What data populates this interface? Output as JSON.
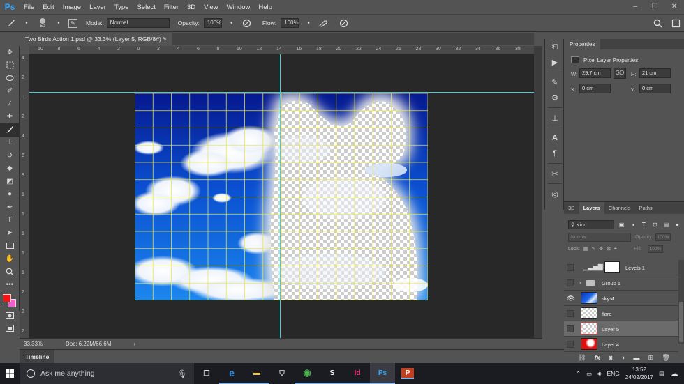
{
  "app": {
    "logo": "Ps",
    "menu": [
      "File",
      "Edit",
      "Image",
      "Layer",
      "Type",
      "Select",
      "Filter",
      "3D",
      "View",
      "Window",
      "Help"
    ],
    "window_controls": [
      "–",
      "❐",
      "✕"
    ]
  },
  "options_bar": {
    "brush_size": "50",
    "mode_label": "Mode:",
    "mode_value": "Normal",
    "opacity_label": "Opacity:",
    "opacity_value": "100%",
    "flow_label": "Flow:",
    "flow_value": "100%"
  },
  "document": {
    "tab_title": "Two Birds Action 1.psd @ 33.3% (Layer 5, RGB/8#) *",
    "close": "×"
  },
  "rulers": {
    "top_labels": [
      "10",
      "8",
      "6",
      "4",
      "2",
      "0",
      "2",
      "4",
      "6",
      "8",
      "10",
      "12",
      "14",
      "16",
      "18",
      "20",
      "22",
      "24",
      "26",
      "28",
      "30",
      "32",
      "34",
      "36",
      "38",
      "40"
    ],
    "left_labels": [
      "4",
      "2",
      "0",
      "2",
      "4",
      "6",
      "8",
      "1",
      "1",
      "1",
      "1",
      "1",
      "2",
      "2",
      "2"
    ]
  },
  "status_bar": {
    "zoom": "33.33%",
    "doc_info": "Doc: 6.22M/66.6M",
    "arrow": "›"
  },
  "timeline": {
    "label": "Timeline"
  },
  "properties": {
    "tab": "Properties",
    "title": "Pixel Layer Properties",
    "w_label": "W:",
    "w_value": "29.7 cm",
    "h_label": "H:",
    "h_value": "21 cm",
    "x_label": "X:",
    "x_value": "0 cm",
    "y_label": "Y:",
    "y_value": "0 cm",
    "link_icon": "GO"
  },
  "layers_panel": {
    "tabs": [
      "3D",
      "Layers",
      "Channels",
      "Paths"
    ],
    "active_tab": "Layers",
    "filter_kind": "Kind",
    "blend_mode": "Normal",
    "opacity_label": "Opacity:",
    "opacity_value": "100%",
    "lock_label": "Lock:",
    "fill_label": "Fill:",
    "fill_value": "100%",
    "layers": [
      {
        "name": "Levels 1",
        "visible": false,
        "thumb": "levels",
        "selected": false
      },
      {
        "name": "Group 1",
        "visible": false,
        "thumb": "group",
        "selected": false
      },
      {
        "name": "sky-4",
        "visible": true,
        "thumb": "sky",
        "selected": false
      },
      {
        "name": "flare",
        "visible": false,
        "thumb": "transparent",
        "selected": false
      },
      {
        "name": "Layer 5",
        "visible": false,
        "thumb": "transparent-red",
        "selected": true
      },
      {
        "name": "Layer 4",
        "visible": false,
        "thumb": "red",
        "selected": false
      }
    ]
  },
  "taskbar": {
    "search_placeholder": "Ask me anything",
    "apps": [
      {
        "name": "task-view",
        "glyph": "❐"
      },
      {
        "name": "edge",
        "glyph": "e"
      },
      {
        "name": "file-explorer",
        "glyph": "▬"
      },
      {
        "name": "store",
        "glyph": "⛉"
      },
      {
        "name": "chrome",
        "glyph": "◉"
      },
      {
        "name": "skype",
        "glyph": "S"
      },
      {
        "name": "indesign",
        "glyph": "Id"
      },
      {
        "name": "photoshop",
        "glyph": "Ps"
      },
      {
        "name": "powerpoint",
        "glyph": "P"
      }
    ],
    "language": "ENG",
    "time": "13:52",
    "date": "24/02/2017"
  },
  "colors": {
    "foreground": "#ff1010",
    "background": "#f060c8",
    "guide": "#3fd0d8",
    "grid": "#e8e84a",
    "accent": "#31a8ff"
  }
}
